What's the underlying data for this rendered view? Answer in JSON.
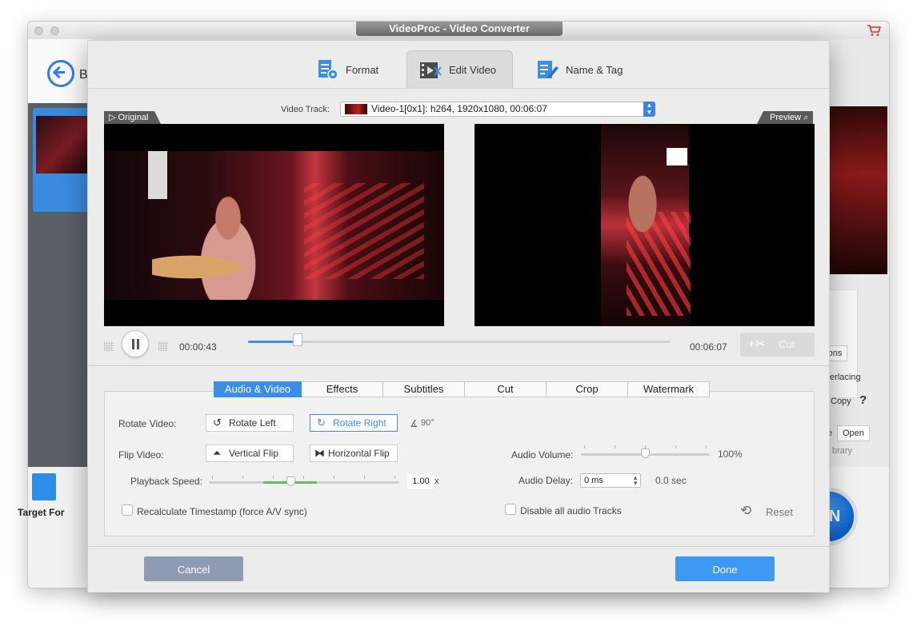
{
  "app": {
    "title": "VideoProc - Video Converter",
    "back_label": "B",
    "target_format_label": "Target For",
    "run_label": "RUN",
    "right_panel": {
      "options_label": "ptions",
      "deinterlacing_label": "terlacing",
      "copy_label": "Copy",
      "help_label": "?",
      "e_label": "e",
      "open_label": "Open",
      "library_label": "brary"
    }
  },
  "dialog": {
    "tabs": [
      {
        "label": "Format",
        "icon": "format-icon"
      },
      {
        "label": "Edit Video",
        "icon": "edit-video-icon",
        "active": true
      },
      {
        "label": "Name & Tag",
        "icon": "name-tag-icon"
      }
    ],
    "video_track": {
      "label": "Video Track:",
      "value": "Video-1[0x1]: h264, 1920x1080, 00:06:07"
    },
    "original_label": "Original",
    "preview_label": "Preview",
    "player": {
      "current_time": "00:00:43",
      "total_time": "00:06:07",
      "progress": 0.117,
      "cut_label": "Cut"
    },
    "sub_tabs": [
      {
        "label": "Audio & Video",
        "active": true
      },
      {
        "label": "Effects"
      },
      {
        "label": "Subtitles"
      },
      {
        "label": "Cut"
      },
      {
        "label": "Crop"
      },
      {
        "label": "Watermark"
      }
    ],
    "settings": {
      "rotate_label": "Rotate Video:",
      "rotate_left": "Rotate Left",
      "rotate_right": "Rotate Right",
      "rotate_angle": "90°",
      "flip_label": "Flip Video:",
      "vertical_flip": "Vertical Flip",
      "horizontal_flip": "Horizontal Flip",
      "playback_speed_label": "Playback Speed:",
      "playback_speed_value": "1.00",
      "playback_speed_unit": "x",
      "recalculate_label": "Recalculate Timestamp (force A/V sync)",
      "audio_volume_label": "Audio Volume:",
      "audio_volume_value": "100%",
      "audio_volume_level": 0.5,
      "audio_delay_label": "Audio Delay:",
      "audio_delay_value": "0 ms",
      "audio_delay_sec": "0.0 sec",
      "disable_audio_label": "Disable all audio Tracks",
      "reset_label": "Reset"
    },
    "footer": {
      "cancel_label": "Cancel",
      "done_label": "Done"
    }
  },
  "colors": {
    "accent": "#3b8ee8",
    "done_button": "#3d9af0",
    "cancel_button": "#8f9bb3",
    "speed_green": "#5cc15c"
  }
}
